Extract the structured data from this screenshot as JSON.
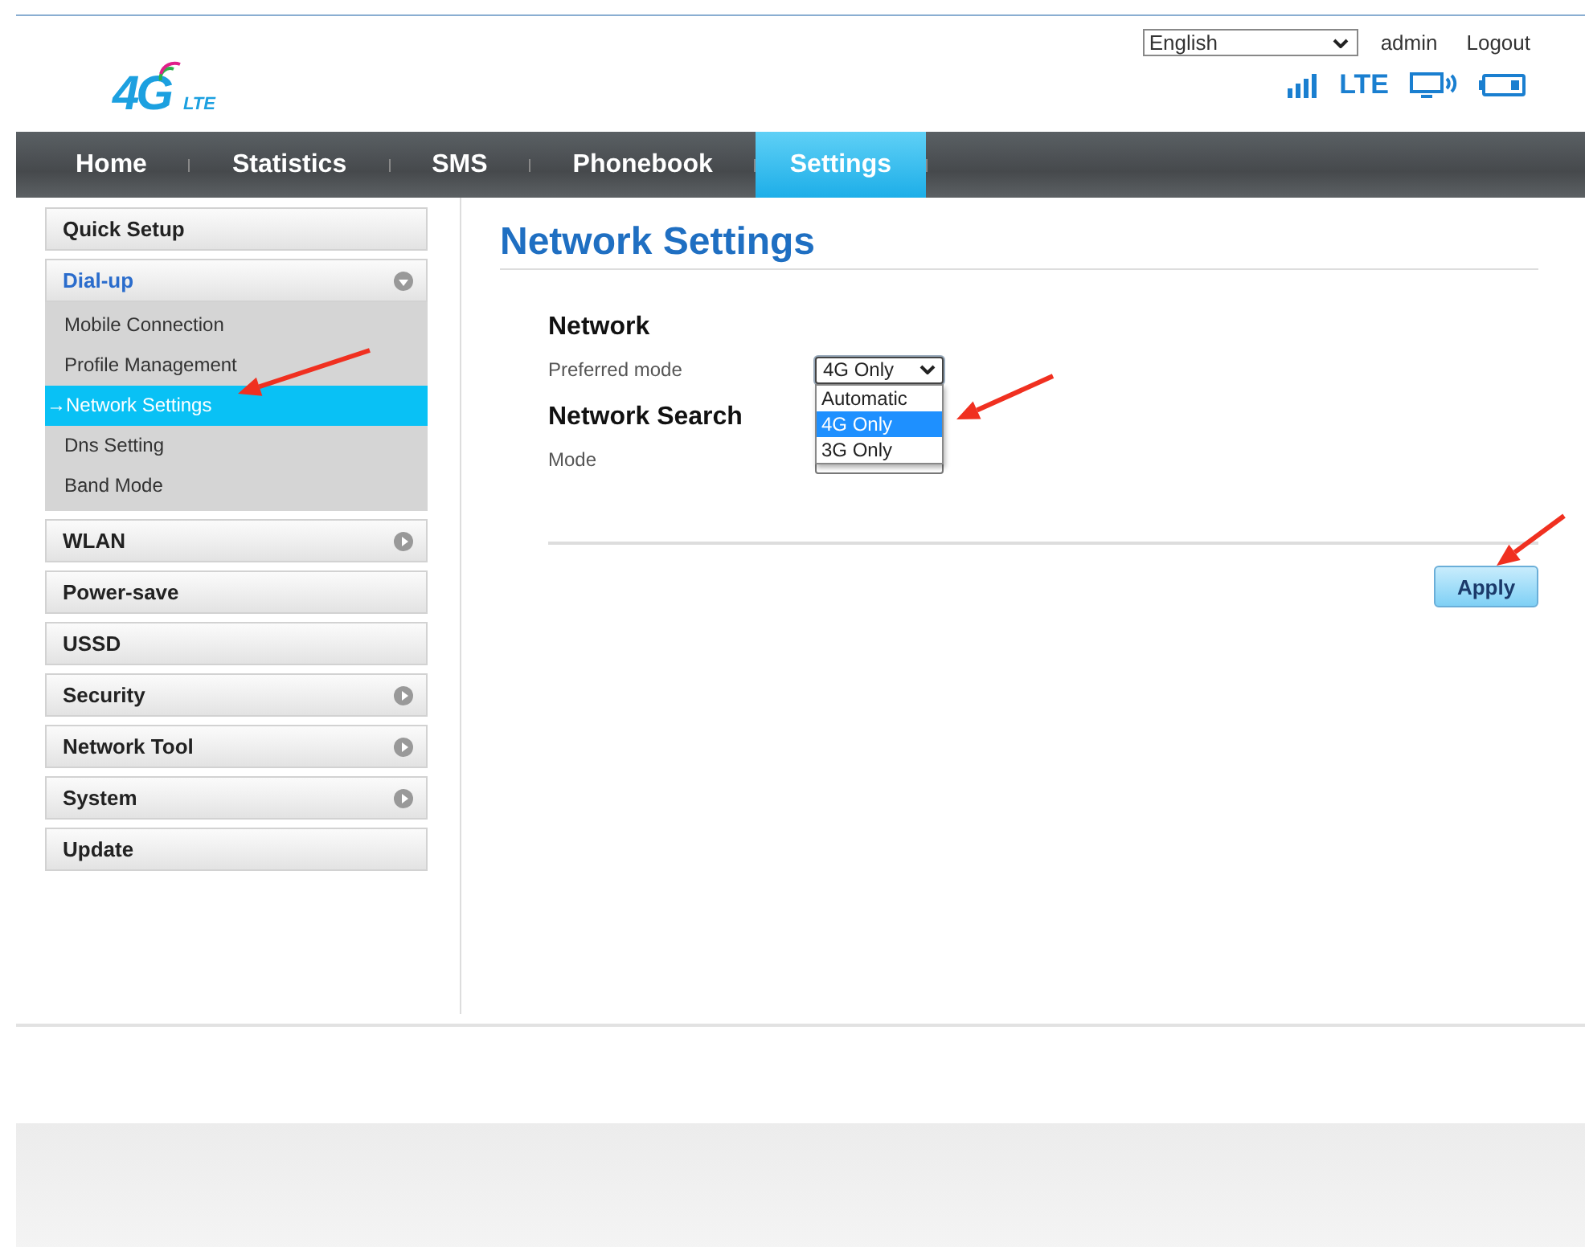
{
  "header": {
    "logo": {
      "text": "4G",
      "sub": "LTE"
    },
    "language": "English",
    "user": "admin",
    "logout": "Logout",
    "network_type": "LTE"
  },
  "nav": [
    {
      "label": "Home",
      "selected": false
    },
    {
      "label": "Statistics",
      "selected": false
    },
    {
      "label": "SMS",
      "selected": false
    },
    {
      "label": "Phonebook",
      "selected": false
    },
    {
      "label": "Settings",
      "selected": true
    }
  ],
  "sidebar": [
    {
      "label": "Quick Setup",
      "kind": "page",
      "selected": false
    },
    {
      "label": "Dial-up",
      "kind": "folder",
      "expanded": true,
      "selected": true,
      "children": [
        {
          "label": "Mobile Connection",
          "selected": false
        },
        {
          "label": "Profile Management",
          "selected": false
        },
        {
          "label": "→Network Settings",
          "selected": true
        },
        {
          "label": "Dns Setting",
          "selected": false
        },
        {
          "label": "Band Mode",
          "selected": false
        }
      ]
    },
    {
      "label": "WLAN",
      "kind": "folder",
      "expanded": false,
      "selected": false
    },
    {
      "label": "Power-save",
      "kind": "page",
      "selected": false
    },
    {
      "label": "USSD",
      "kind": "page",
      "selected": false
    },
    {
      "label": "Security",
      "kind": "folder",
      "expanded": false,
      "selected": false
    },
    {
      "label": "Network Tool",
      "kind": "folder",
      "expanded": false,
      "selected": false
    },
    {
      "label": "System",
      "kind": "folder",
      "expanded": false,
      "selected": false
    },
    {
      "label": "Update",
      "kind": "page",
      "selected": false
    }
  ],
  "main": {
    "title": "Network Settings",
    "sections": [
      {
        "heading": "Network",
        "fields": [
          {
            "label": "Preferred mode",
            "value": "4G Only",
            "expanded": true,
            "options": [
              {
                "label": "Automatic",
                "selected": false
              },
              {
                "label": "4G Only",
                "selected": true
              },
              {
                "label": "3G Only",
                "selected": false
              }
            ]
          }
        ]
      },
      {
        "heading": "Network Search",
        "fields": [
          {
            "label": "Mode",
            "expanded": false
          }
        ]
      }
    ],
    "apply": "Apply"
  }
}
